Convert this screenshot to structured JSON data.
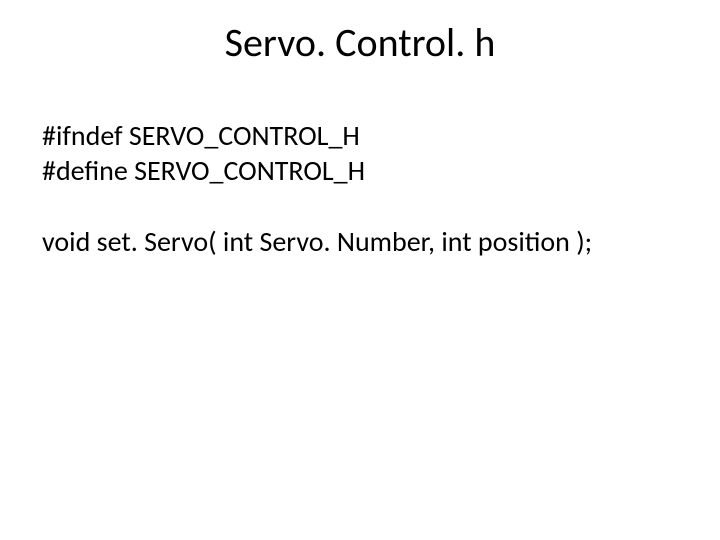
{
  "title": "Servo. Control. h",
  "code": {
    "line1": "#ifndef SERVO_CONTROL_H",
    "line2": "#define SERVO_CONTROL_H",
    "line3": "void set. Servo( int Servo. Number, int position );"
  }
}
